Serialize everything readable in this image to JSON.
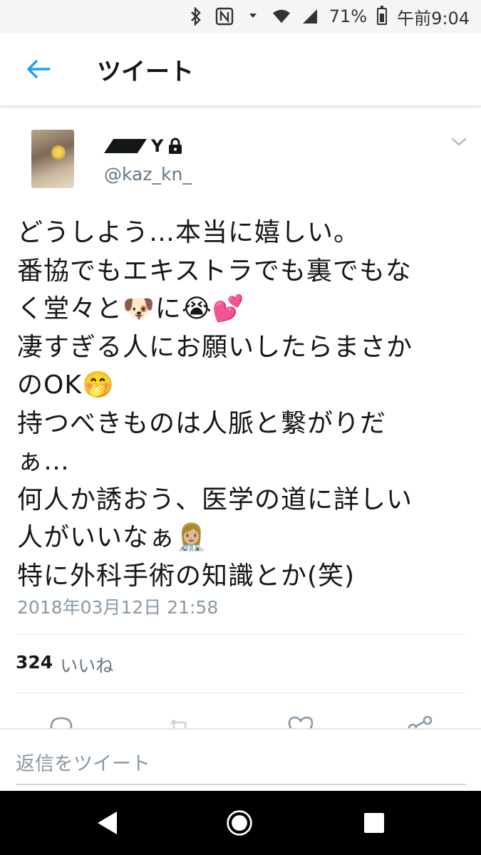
{
  "status_bar": {
    "battery": "71%",
    "time": "午前9:04",
    "icons": [
      "bluetooth-icon",
      "nfc-icon",
      "data-arrows-icon",
      "wifi-icon",
      "signal-icon",
      "battery-icon"
    ]
  },
  "header": {
    "title": "ツイート",
    "back_icon": "arrow-left-icon",
    "accent": "#1da1f2"
  },
  "tweet": {
    "display_name_suffix": "Y",
    "protected_icon": "lock-icon",
    "handle": "@kaz_kn_",
    "text": "どうしよう…本当に嬉しい。\n番協でもエキストラでも裏でもな\nく堂々と🐶に😭💕\n凄すぎる人にお願いしたらまさか\nのOK🤭\n持つべきものは人脈と繋がりだ\nぁ…\n何人か誘おう、医学の道に詳しい\n人がいいなぁ👩🏼‍⚕️\n特に外科手術の知識とか(笑)",
    "timestamp": "2018年03月12日 21:58",
    "likes_count": "324",
    "likes_label": "いいね"
  },
  "actions": [
    "reply-icon",
    "retweet-icon",
    "like-icon",
    "share-icon"
  ],
  "reply": {
    "placeholder": "返信をツイート"
  },
  "navbar": [
    "back-triangle-icon",
    "home-circle-icon",
    "recents-square-icon"
  ]
}
